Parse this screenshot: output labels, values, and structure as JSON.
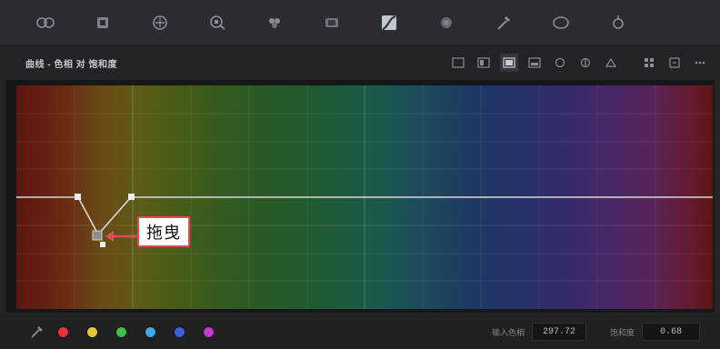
{
  "toolbar": {
    "tools": [
      {
        "name": "colour-wheels-tool-icon"
      },
      {
        "name": "hdr-grid-tool-icon"
      },
      {
        "name": "rgb-mixer-tool-icon"
      },
      {
        "name": "primaries-tool-icon"
      },
      {
        "name": "motion-effects-tool-icon"
      },
      {
        "name": "camera-raw-tool-icon"
      },
      {
        "name": "curves-tool-icon",
        "active": true
      },
      {
        "name": "colour-warper-tool-icon"
      },
      {
        "name": "qualifier-eyedropper-tool-icon"
      },
      {
        "name": "window-tool-icon"
      },
      {
        "name": "tracker-tool-icon"
      }
    ]
  },
  "subbar": {
    "title": "曲线 - 色相 对 饱和度",
    "modes": [
      "custom-curve-mode-icon",
      "hue-vs-hue-mode-icon",
      "hue-vs-sat-mode-icon",
      "hue-vs-lum-mode-icon",
      "lum-vs-sat-mode-icon",
      "sat-vs-sat-mode-icon",
      "sat-vs-lum-mode-icon"
    ],
    "active_mode": 2,
    "extras": [
      "grid-options-icon",
      "reset-icon",
      "more-options-icon"
    ]
  },
  "annotation": {
    "drag_label": "拖曳"
  },
  "bottombar": {
    "swatches": [
      {
        "name": "red-swatch",
        "color": "#e8333a"
      },
      {
        "name": "yellow-swatch",
        "color": "#e6c63a"
      },
      {
        "name": "green-swatch",
        "color": "#3fbf4a"
      },
      {
        "name": "cyan-swatch",
        "color": "#3fa7e6"
      },
      {
        "name": "blue-swatch",
        "color": "#3a63d8"
      },
      {
        "name": "magenta-swatch",
        "color": "#c23ad0"
      }
    ],
    "input_hue_label": "输入色相",
    "input_hue_value": "297.72",
    "saturation_label": "饱和度",
    "saturation_value": "0.68"
  },
  "colors": {
    "curve": "#d8d8d8",
    "annotation_border": "#e24a5c"
  }
}
